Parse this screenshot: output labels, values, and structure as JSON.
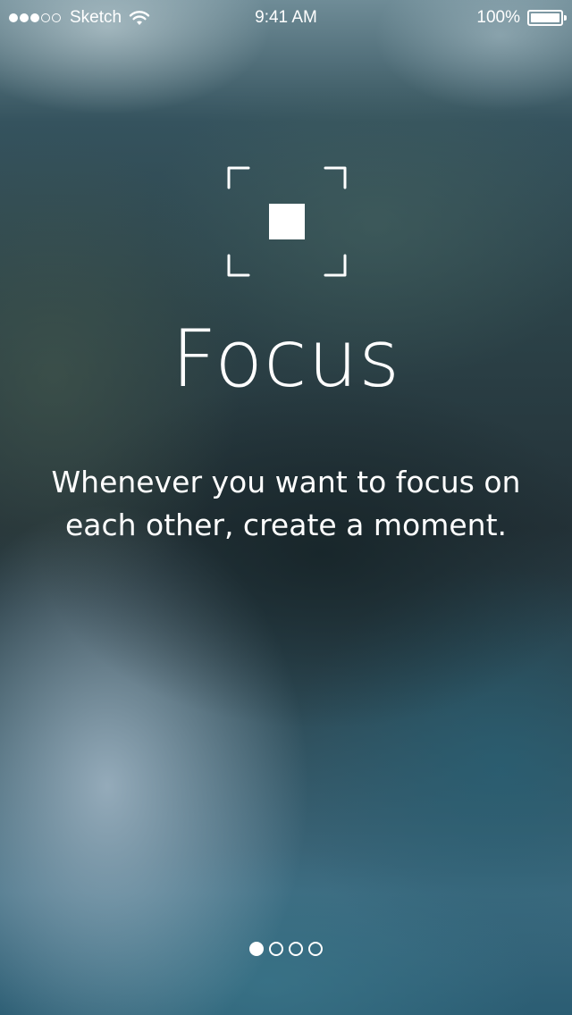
{
  "status_bar": {
    "signal_bars_filled": 3,
    "signal_bars_total": 5,
    "carrier": "Sketch",
    "wifi_icon": "wifi-icon",
    "time": "9:41 AM",
    "battery_percent": "100%",
    "battery_level": 1.0
  },
  "onboarding": {
    "icon": "focus-frame-icon",
    "title": "Focus",
    "description": "Whenever you want to focus on each other, create a moment."
  },
  "pager": {
    "total_pages": 4,
    "current_page": 1
  },
  "colors": {
    "text": "#ffffff",
    "background_dark": "#233238",
    "background_light": "#a5b9c8"
  }
}
